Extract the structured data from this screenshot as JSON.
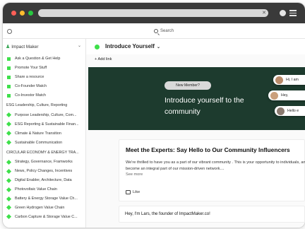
{
  "colors": {
    "accent": "#3ee04a",
    "banner_bg": "#1d3b2e",
    "browser_bar": "#3a3a3a"
  },
  "browser": {
    "close_icon": "close-icon",
    "menu_icon": "hamburger-menu-icon"
  },
  "topbar": {
    "search_label": "Search"
  },
  "sidebar": {
    "community_name": "Impact Maker",
    "top_items": [
      {
        "label": "Ask a Question & Get Help"
      },
      {
        "label": "Promote Your Stuff"
      },
      {
        "label": "Share a resource"
      },
      {
        "label": "Co-Founder Match"
      },
      {
        "label": "Co-Investor Match"
      }
    ],
    "sections": [
      {
        "title": "ESG Leadership, Culture, Reporting",
        "items": [
          {
            "label": "Purpose Leadership, Culture, Com..."
          },
          {
            "label": "ESG Reporting & Sustainable Finan..."
          },
          {
            "label": "Climate & Nature Transition"
          },
          {
            "label": "Sustainable Communication"
          }
        ]
      },
      {
        "title": "CIRCULAR ECONOMY & ENERGY TRA...",
        "items": [
          {
            "label": "Strategy, Governance, Framworks"
          },
          {
            "label": "News, Policy Changes, Incentives"
          },
          {
            "label": "Digital Enabler, Architecture, Data"
          },
          {
            "label": "Photovoltaic Value Chain"
          },
          {
            "label": "Battery & Energy Storage Value Ch..."
          },
          {
            "label": "Green Hydrogen Value Chain"
          },
          {
            "label": "Carbon Capture & Storage Value C..."
          }
        ]
      }
    ]
  },
  "main": {
    "title": "Introduce Yourself",
    "add_link_label": "Add link",
    "banner": {
      "pill": "New Member?",
      "headline": "Introduce yourself to the community",
      "chips": [
        {
          "text": "Hi, I am"
        },
        {
          "text": "Hey,"
        },
        {
          "text": "Hello e"
        }
      ]
    },
    "post": {
      "title": "Meet the Experts: Say Hello to Our Community Influencers",
      "body": "We're thrilled to have you as a part of our vibrant community . This is your opportunity to individuals, and become an integral part of our mission-driven network....",
      "see_more": "See more",
      "like_label": "Like"
    },
    "post2": {
      "text": "Hey, I'm Lars, the founder of ImpactMaker.co!"
    }
  }
}
